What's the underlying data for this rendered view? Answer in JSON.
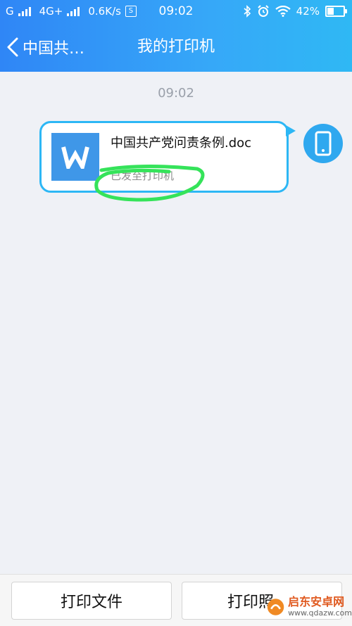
{
  "status_bar": {
    "network_left": "G",
    "network_mid": "4G+",
    "speed": "0.6K/s",
    "s_icon": "S",
    "time": "09:02",
    "battery": "42%"
  },
  "header": {
    "back_title": "中国共…",
    "title": "我的打印机"
  },
  "chat": {
    "timestamp": "09:02",
    "message": {
      "file_name": "中国共产党问责条例.doc",
      "status": "已发至打印机"
    }
  },
  "bottom": {
    "print_file": "打印文件",
    "print_photo": "打印照"
  },
  "watermark": {
    "name": "启东安卓网",
    "url": "www.qdazw.com"
  },
  "colors": {
    "header_gradient_start": "#2f86f6",
    "header_gradient_end": "#2fb8f4",
    "bubble_border": "#2db7f5",
    "doc_icon": "#3f97e8",
    "highlight": "#35e35a"
  }
}
